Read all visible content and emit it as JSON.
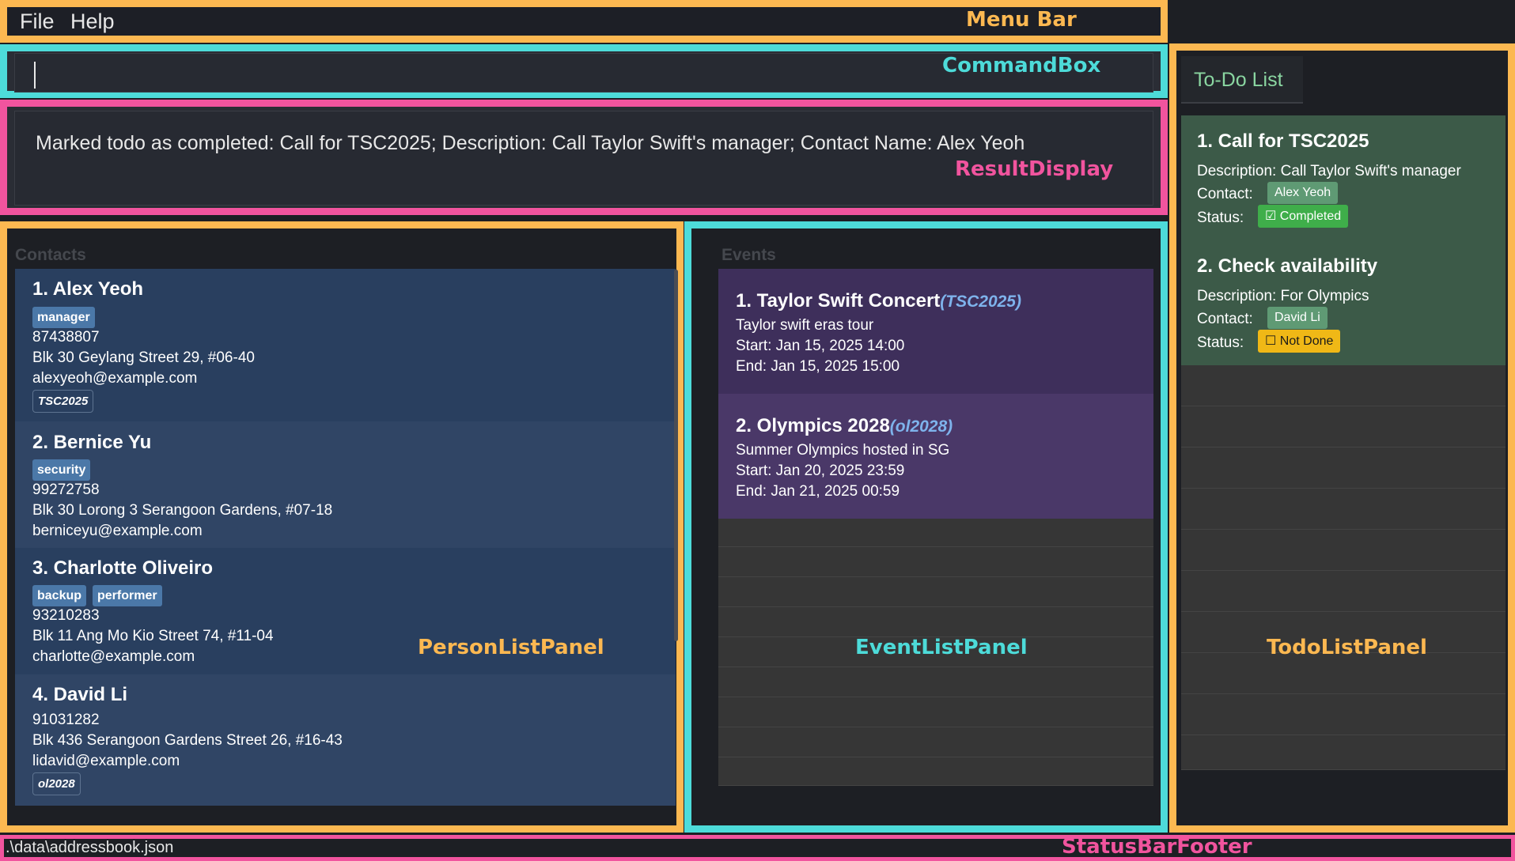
{
  "menu": {
    "items": [
      "File",
      "Help"
    ],
    "annotation": "Menu Bar"
  },
  "command_box": {
    "value": "",
    "annotation": "CommandBox"
  },
  "result_display": {
    "text": "Marked todo as completed: Call for TSC2025; Description: Call Taylor Swift's manager; Contact Name: Alex Yeoh",
    "annotation": "ResultDisplay"
  },
  "person_panel": {
    "title": "Contacts",
    "annotation": "PersonListPanel",
    "persons": [
      {
        "name": "1. Alex Yeoh",
        "tags": [
          "manager"
        ],
        "phone": "87438807",
        "address": "Blk 30 Geylang Street 29, #06-40",
        "email": "alexyeoh@example.com",
        "events": [
          "TSC2025"
        ]
      },
      {
        "name": "2. Bernice Yu",
        "tags": [
          "security"
        ],
        "phone": "99272758",
        "address": "Blk 30 Lorong 3 Serangoon Gardens, #07-18",
        "email": "berniceyu@example.com",
        "events": []
      },
      {
        "name": "3. Charlotte Oliveiro",
        "tags": [
          "backup",
          "performer"
        ],
        "phone": "93210283",
        "address": "Blk 11 Ang Mo Kio Street 74, #11-04",
        "email": "charlotte@example.com",
        "events": []
      },
      {
        "name": "4. David Li",
        "tags": [],
        "phone": "91031282",
        "address": "Blk 436 Serangoon Gardens Street 26, #16-43",
        "email": "lidavid@example.com",
        "events": [
          "ol2028"
        ]
      }
    ]
  },
  "event_panel": {
    "title": "Events",
    "annotation": "EventListPanel",
    "events": [
      {
        "name": "1. Taylor Swift Concert",
        "tag": "(TSC2025)",
        "description": "Taylor swift eras tour",
        "start": "Start: Jan 15, 2025 14:00",
        "end": "End: Jan 15, 2025 15:00"
      },
      {
        "name": "2. Olympics 2028",
        "tag": "(ol2028)",
        "description": "Summer Olympics hosted in SG",
        "start": "Start: Jan 20, 2025 23:59",
        "end": "End: Jan 21, 2025 00:59"
      }
    ]
  },
  "todo_panel": {
    "tab_label": "To-Do List",
    "annotation": "TodoListPanel",
    "contact_label": "Contact:",
    "status_label": "Status:",
    "todos": [
      {
        "name": "1. Call for TSC2025",
        "description": "Description: Call Taylor Swift's manager",
        "contact": "Alex Yeoh",
        "status": "☑ Completed"
      },
      {
        "name": "2. Check availability",
        "description": "Description: For Olympics",
        "contact": "David Li",
        "status": "☐ Not Done"
      }
    ]
  },
  "status_bar": {
    "path": ".\\data\\addressbook.json",
    "annotation": "StatusBarFooter"
  },
  "colors": {
    "menu_annotation": "#fcb851",
    "command_annotation": "#4ddbd9",
    "result_annotation": "#f1549e",
    "status_completed_bg": "#3fae4a",
    "status_not_done_bg": "#f0b816"
  }
}
